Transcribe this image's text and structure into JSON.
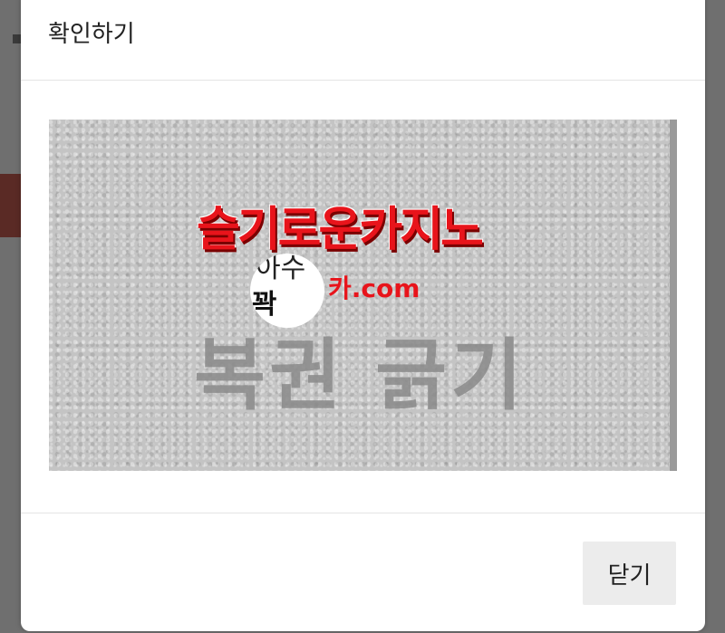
{
  "modal": {
    "title": "확인하기",
    "close_label": "닫기"
  },
  "captcha": {
    "text": "복권 긁기",
    "overlay_logo_text": "슬기로운카지노",
    "overlay_domain_text": "카.com",
    "overlay_circle_text_top": "아수",
    "overlay_circle_text_bottom": "꽉"
  },
  "colors": {
    "logo_red": "#e8141b",
    "backdrop": "#6f6f6f",
    "captcha_bg": "#c4c4c4",
    "button_bg": "#ececec"
  }
}
